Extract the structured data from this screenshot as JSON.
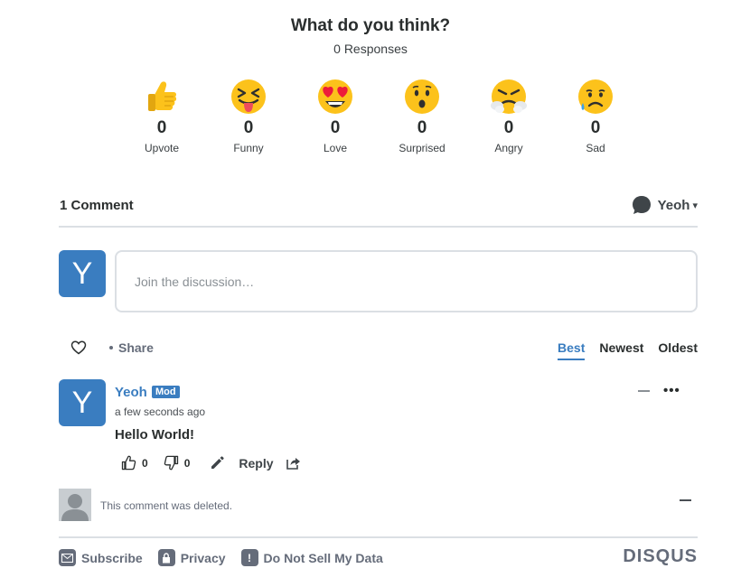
{
  "reactions_header": {
    "title": "What do you think?",
    "responses": "0 Responses"
  },
  "reactions": [
    {
      "icon": "thumbs-up-emoji",
      "count": "0",
      "label": "Upvote"
    },
    {
      "icon": "squinting-tongue-emoji",
      "count": "0",
      "label": "Funny"
    },
    {
      "icon": "heart-eyes-emoji",
      "count": "0",
      "label": "Love"
    },
    {
      "icon": "astonished-emoji",
      "count": "0",
      "label": "Surprised"
    },
    {
      "icon": "angry-steam-emoji",
      "count": "0",
      "label": "Angry"
    },
    {
      "icon": "sad-tear-emoji",
      "count": "0",
      "label": "Sad"
    }
  ],
  "comments_header": {
    "count_label": "1 Comment",
    "user_name": "Yeoh",
    "caret": "▾"
  },
  "composer": {
    "avatar_letter": "Y",
    "placeholder": "Join the discussion…"
  },
  "toolbar": {
    "share_label": "Share",
    "sort_tabs": [
      "Best",
      "Newest",
      "Oldest"
    ],
    "active_sort": "Best"
  },
  "comment": {
    "avatar_letter": "Y",
    "author": "Yeoh",
    "badge": "Mod",
    "timestamp": "a few seconds ago",
    "body": "Hello World!",
    "upvotes": "0",
    "downvotes": "0",
    "reply_label": "Reply",
    "more_label": "•••"
  },
  "deleted_comment": {
    "text": "This comment was deleted."
  },
  "footer": {
    "subscribe_label": "Subscribe",
    "privacy_label": "Privacy",
    "dnsmd_label": "Do Not Sell My Data",
    "logo_text": "DISQUS"
  },
  "colors": {
    "accent": "#3a7dc0",
    "text": "#2a2e2e",
    "muted": "#656c7a",
    "border": "#dbdfe4",
    "emoji_yellow": "#fcc21b"
  }
}
